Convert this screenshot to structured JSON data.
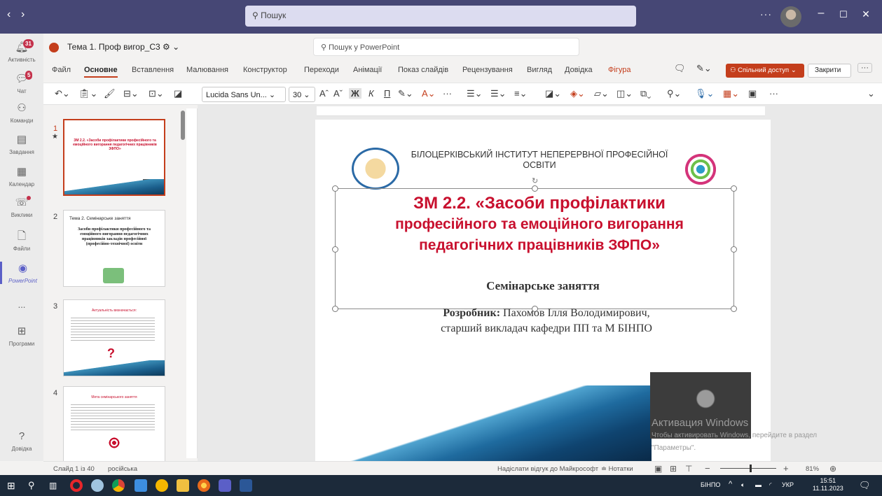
{
  "teams": {
    "search_placeholder": "Пошук",
    "rail": [
      {
        "label": "Активність",
        "badge": "31"
      },
      {
        "label": "Чат",
        "badge": "5"
      },
      {
        "label": "Команди"
      },
      {
        "label": "Завдання"
      },
      {
        "label": "Календар"
      },
      {
        "label": "Виклики"
      },
      {
        "label": "Файли"
      },
      {
        "label": "PowerPoint"
      },
      {
        "label": "..."
      },
      {
        "label": "Програми"
      },
      {
        "label": "Довідка"
      }
    ]
  },
  "ppt": {
    "doc_title": "Тема 1. Проф вигор_С3",
    "search_placeholder": "Пошук у PowerPoint",
    "tabs": [
      "Файл",
      "Основне",
      "Вставлення",
      "Малювання",
      "Конструктор",
      "Переходи",
      "Анімації",
      "Показ слайдів",
      "Рецензування",
      "Вигляд",
      "Довідка",
      "Фігура"
    ],
    "share_label": "Спільний доступ",
    "close_label": "Закрити",
    "font_name": "Lucida Sans Un...",
    "font_size": "30"
  },
  "thumbs": [
    {
      "num": "1",
      "title": "ЗМ 2.2. «Засоби профілактики професійного та емоційного вигорання педагогічних працівників ЗФПО»"
    },
    {
      "num": "2",
      "heading": "Тема 2. Семінарське заняття",
      "title": "Засоби профілактики професійного та емоційного вигорання педагогічних працівників закладів професійної (професійно-технічної) освіти"
    },
    {
      "num": "3",
      "title": "Актуальність визначається:"
    },
    {
      "num": "4",
      "title": "Мета семінарського заняття"
    }
  ],
  "slide": {
    "institute": "БІЛОЦЕРКІВСЬКИЙ ІНСТИТУТ НЕПЕРЕРВНОЇ ПРОФЕСІЙНОЇ ОСВІТИ",
    "title_line1": "ЗМ 2.2. «Засоби профілактики",
    "title_line2": "професійного та емоційного вигорання",
    "title_line3": "педагогічних працівників ЗФПО»",
    "subtitle": "Семінарське заняття",
    "author_label": "Розробник:",
    "author_name": "Пахомов Ілля Володимирович,",
    "author_position": "старший викладач кафедри ПП та М БІНПО",
    "watermark_line1": "Активация Windows",
    "watermark_line2": "Чтобы активировать Windows, перейдите в раздел",
    "watermark_line3": "\"Параметры\"."
  },
  "status": {
    "slide_count": "Слайд 1 із 40",
    "language": "російська",
    "feedback": "Надіслати відгук до Майкрософт",
    "notes": "Нотатки",
    "zoom": "81%"
  },
  "taskbar": {
    "lang_label": "БІНПО",
    "keyboard": "УКР",
    "time": "15:51",
    "date": "11.11.2023"
  }
}
